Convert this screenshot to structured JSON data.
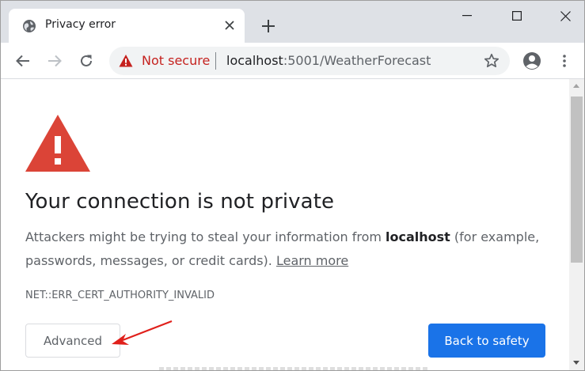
{
  "tab": {
    "title": "Privacy error",
    "favicon": "globe-icon",
    "close": "close-icon"
  },
  "window_controls": [
    "minimize-icon",
    "maximize-icon",
    "close-icon"
  ],
  "toolbar": {
    "back": "back-arrow-icon",
    "forward": "forward-arrow-icon",
    "reload": "reload-icon",
    "security_label": "Not secure",
    "url_host": "localhost",
    "url_rest": ":5001/WeatherForecast",
    "bookmark": "star-icon",
    "profile": "profile-icon",
    "menu": "kebab-menu-icon"
  },
  "page": {
    "heading": "Your connection is not private",
    "desc_before": "Attackers might be trying to steal your information from ",
    "desc_host": "localhost",
    "desc_after": " (for example, passwords, messages, or credit cards). ",
    "learn_more": "Learn more",
    "error_code": "NET::ERR_CERT_AUTHORITY_INVALID",
    "advanced_label": "Advanced",
    "safety_label": "Back to safety"
  },
  "colors": {
    "danger_red": "#db4437",
    "not_secure_red": "#c5221f",
    "primary_blue": "#1a73e8",
    "annotation_arrow": "#e0201b"
  }
}
